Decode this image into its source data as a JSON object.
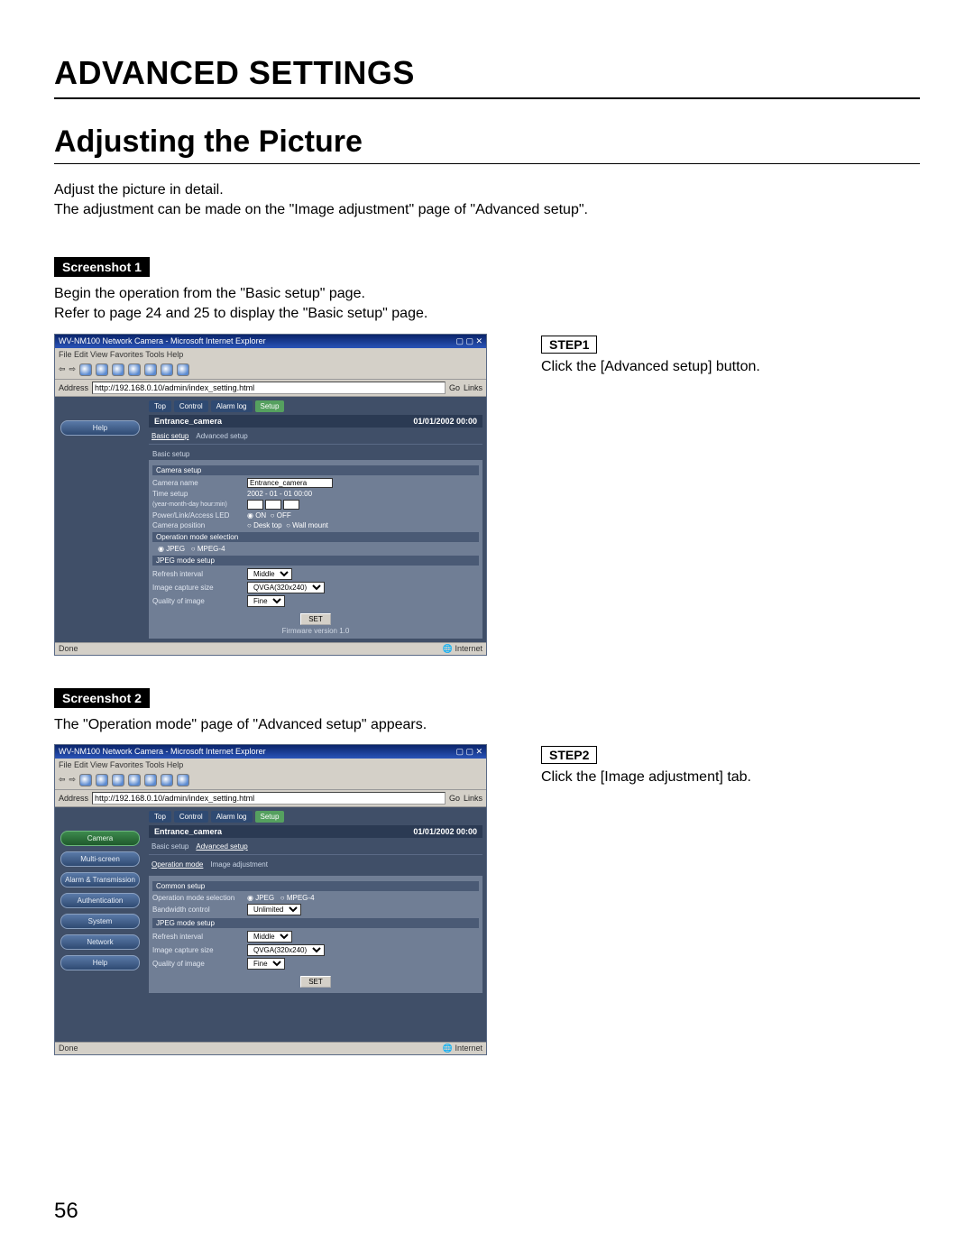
{
  "page_title": "ADVANCED SETTINGS",
  "section_title": "Adjusting the Picture",
  "intro": [
    "Adjust the picture in detail.",
    "The adjustment can be made on the \"Image adjustment\" page of \"Advanced setup\"."
  ],
  "page_number": "56",
  "s1": {
    "label": "Screenshot 1",
    "desc": [
      "Begin the operation from the \"Basic setup\" page.",
      "Refer to page 24 and 25 to display the \"Basic setup\" page."
    ],
    "step_label": "STEP1",
    "step_text": "Click the [Advanced setup] button.",
    "win_title": "WV-NM100 Network Camera - Microsoft Internet Explorer",
    "menubar": "File   Edit   View   Favorites   Tools   Help",
    "addr_label": "Address",
    "addr_value": "http://192.168.0.10/admin/index_setting.html",
    "addr_go": "Go",
    "addr_links": "Links",
    "tabs": [
      "Top",
      "Control",
      "Alarm log",
      "Setup"
    ],
    "header_cam": "Entrance_camera",
    "header_time": "01/01/2002  00:00",
    "subtabs": [
      "Basic setup",
      "Advanced setup"
    ],
    "side": [
      "Help"
    ],
    "subpage": "Basic setup",
    "panel_heads": {
      "camera": "Camera setup",
      "opmode": "Operation mode selection",
      "jpeg": "JPEG mode setup"
    },
    "rows": {
      "camera_name_l": "Camera name",
      "camera_name_v": "Entrance_camera",
      "time_setup_l": "Time setup",
      "time_setup_v": "2002 - 01 - 01  00:00",
      "time_fmt_l": "(year-month-day hour:min)",
      "led_l": "Power/Link/Access LED",
      "led_on": "ON",
      "led_off": "OFF",
      "pos_l": "Camera position",
      "pos_desk": "Desk top",
      "pos_wall": "Wall mount",
      "op_jpeg": "JPEG",
      "op_mpeg": "MPEG-4",
      "refresh_l": "Refresh interval",
      "refresh_v": "Middle",
      "size_l": "Image capture size",
      "size_v": "QVGA(320x240)",
      "quality_l": "Quality of image",
      "quality_v": "Fine"
    },
    "set_btn": "SET",
    "firmware": "Firmware version  1.0",
    "status_l": "Done",
    "status_r": "Internet"
  },
  "s2": {
    "label": "Screenshot 2",
    "desc": [
      "The \"Operation mode\" page of \"Advanced setup\" appears."
    ],
    "step_label": "STEP2",
    "step_text": "Click the [Image adjustment] tab.",
    "win_title": "WV-NM100 Network Camera - Microsoft Internet Explorer",
    "menubar": "File   Edit   View   Favorites   Tools   Help",
    "addr_label": "Address",
    "addr_value": "http://192.168.0.10/admin/index_setting.html",
    "addr_go": "Go",
    "addr_links": "Links",
    "tabs": [
      "Top",
      "Control",
      "Alarm log",
      "Setup"
    ],
    "header_cam": "Entrance_camera",
    "header_time": "01/01/2002  00:00",
    "subtabs": [
      "Basic setup",
      "Advanced setup"
    ],
    "side": [
      "Camera",
      "Multi-screen",
      "Alarm & Transmission",
      "Authentication",
      "System",
      "Network",
      "Help"
    ],
    "innertabs": [
      "Operation mode",
      "Image adjustment"
    ],
    "panel_heads": {
      "common": "Common setup",
      "jpeg": "JPEG mode setup"
    },
    "rows": {
      "opmode_l": "Operation mode selection",
      "op_jpeg": "JPEG",
      "op_mpeg": "MPEG-4",
      "bw_l": "Bandwidth control",
      "bw_v": "Unlimited",
      "refresh_l": "Refresh interval",
      "refresh_v": "Middle",
      "size_l": "Image capture size",
      "size_v": "QVGA(320x240)",
      "quality_l": "Quality of image",
      "quality_v": "Fine"
    },
    "set_btn": "SET",
    "status_l": "Done",
    "status_r": "Internet"
  }
}
